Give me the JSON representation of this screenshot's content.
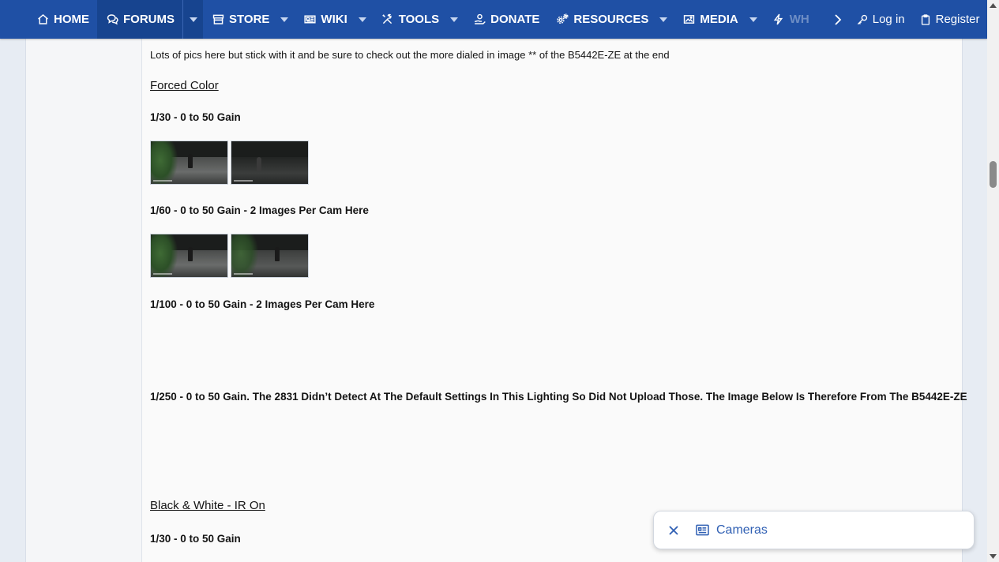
{
  "nav": {
    "items": [
      {
        "label": "HOME",
        "icon": "home-icon",
        "dropdown": false,
        "active": false
      },
      {
        "label": "FORUMS",
        "icon": "chat-icon",
        "dropdown": true,
        "active": true
      },
      {
        "label": "STORE",
        "icon": "store-icon",
        "dropdown": true,
        "active": false
      },
      {
        "label": "WIKI",
        "icon": "newspaper-icon",
        "dropdown": true,
        "active": false
      },
      {
        "label": "TOOLS",
        "icon": "tools-icon",
        "dropdown": true,
        "active": false
      },
      {
        "label": "DONATE",
        "icon": "donate-icon",
        "dropdown": false,
        "active": false
      },
      {
        "label": "RESOURCES",
        "icon": "cogs-icon",
        "dropdown": true,
        "active": false
      },
      {
        "label": "MEDIA",
        "icon": "image-icon",
        "dropdown": true,
        "active": false
      },
      {
        "label": "WH",
        "icon": "bolt-icon",
        "dropdown": false,
        "active": false
      }
    ],
    "login_label": "Log in",
    "register_label": "Register"
  },
  "post": {
    "intro": "Lots of pics here but stick with it and be sure to check out the more dialed in image ** of the B5442E-ZE at the end",
    "section1_heading": "Forced Color",
    "section1_sub1": "1/30 - 0 to 50 Gain",
    "section1_sub2": "1/60 - 0 to 50 Gain - 2 Images Per Cam Here",
    "section1_sub3": "1/100 - 0 to 50 Gain - 2 Images Per Cam Here",
    "section1_sub4": "1/250 - 0 to 50 Gain. The 2831 Didn’t Detect At The Default Settings In This Lighting So Did Not Upload Those. The Image Below Is Therefore From The B5442E-ZE",
    "section2_heading": "Black & White - IR On",
    "section2_sub1": "1/30 - 0 to 50 Gain"
  },
  "toast": {
    "label": "Cameras",
    "icon": "list-icon"
  },
  "colors": {
    "nav_bg": "#1f50a5",
    "accent": "#2f5fb3"
  }
}
